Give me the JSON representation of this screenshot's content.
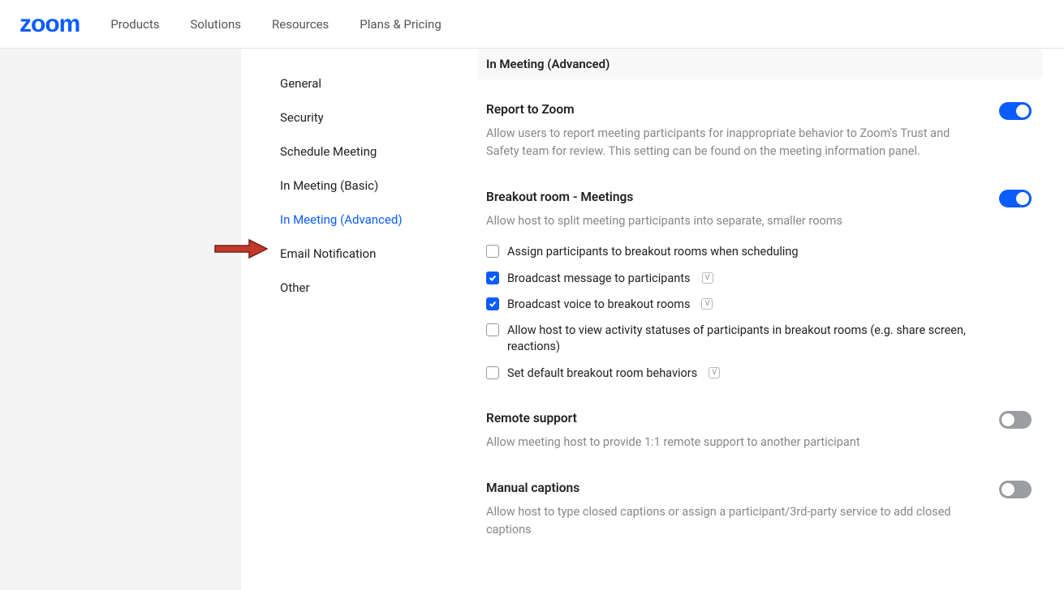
{
  "header": {
    "logo": "zoom",
    "nav": [
      "Products",
      "Solutions",
      "Resources",
      "Plans & Pricing"
    ]
  },
  "sidebar": {
    "items": [
      {
        "label": "General",
        "active": false
      },
      {
        "label": "Security",
        "active": false
      },
      {
        "label": "Schedule Meeting",
        "active": false
      },
      {
        "label": "In Meeting (Basic)",
        "active": false
      },
      {
        "label": "In Meeting (Advanced)",
        "active": true
      },
      {
        "label": "Email Notification",
        "active": false
      },
      {
        "label": "Other",
        "active": false
      }
    ]
  },
  "section_header": "In Meeting (Advanced)",
  "settings": {
    "report": {
      "title": "Report to Zoom",
      "desc": "Allow users to report meeting participants for inappropriate behavior to Zoom's Trust and Safety team for review. This setting can be found on the meeting information panel.",
      "toggle_on": true
    },
    "breakout": {
      "title": "Breakout room - Meetings",
      "desc": "Allow host to split meeting participants into separate, smaller rooms",
      "toggle_on": true,
      "options": [
        {
          "label": "Assign participants to breakout rooms when scheduling",
          "checked": false,
          "info": false
        },
        {
          "label": "Broadcast message to participants",
          "checked": true,
          "info": true
        },
        {
          "label": "Broadcast voice to breakout rooms",
          "checked": true,
          "info": true
        },
        {
          "label": "Allow host to view activity statuses of participants in breakout rooms (e.g. share screen, reactions)",
          "checked": false,
          "info": false
        },
        {
          "label": "Set default breakout room behaviors",
          "checked": false,
          "info": true
        }
      ]
    },
    "remote": {
      "title": "Remote support",
      "desc": "Allow meeting host to provide 1:1 remote support to another participant",
      "toggle_on": false
    },
    "captions": {
      "title": "Manual captions",
      "desc": "Allow host to type closed captions or assign a participant/3rd-party service to add closed captions",
      "toggle_on": false
    }
  }
}
